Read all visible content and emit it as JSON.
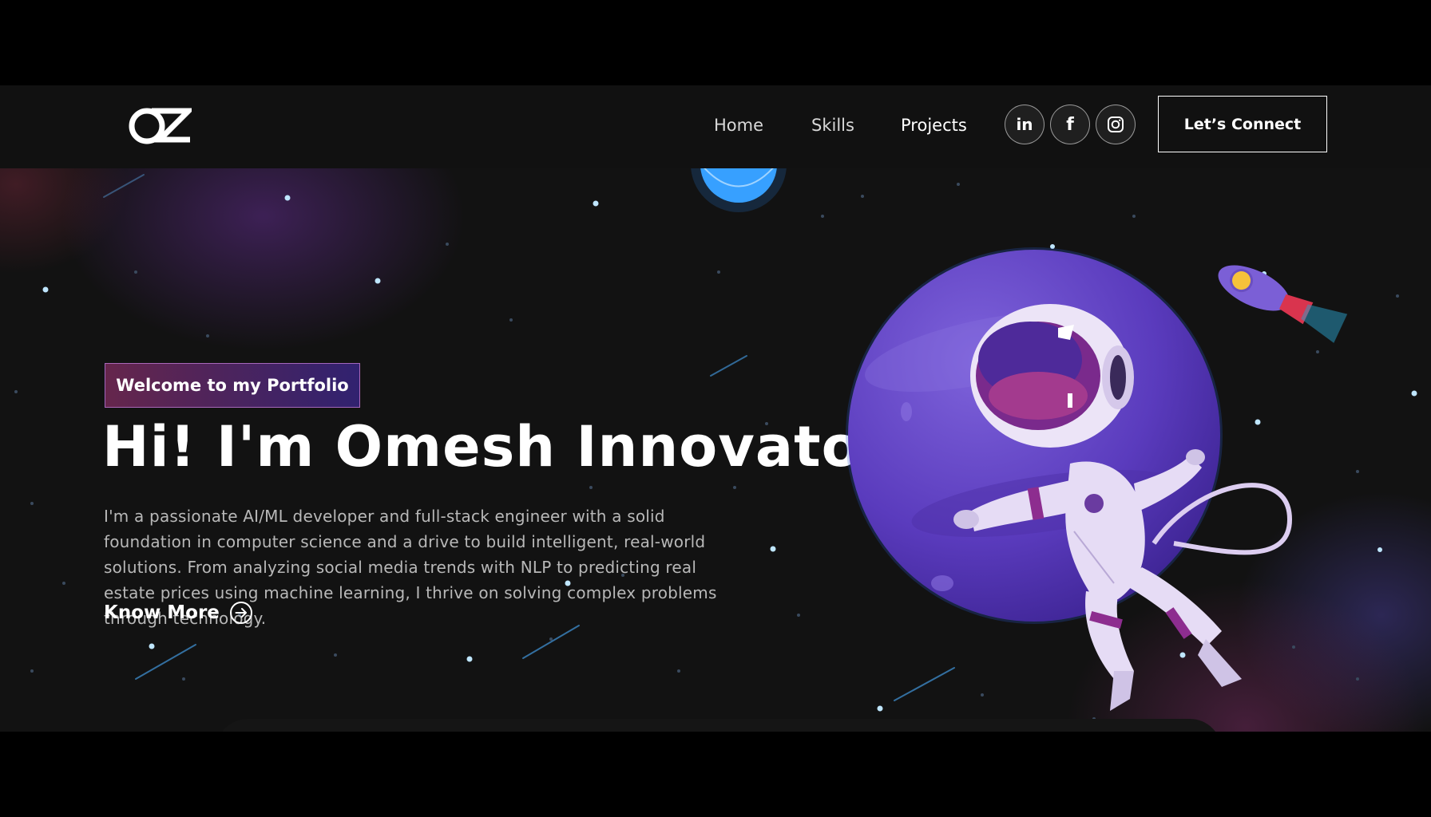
{
  "navbar": {
    "logo_text": "OZ",
    "links": [
      "Home",
      "Skills",
      "Projects"
    ],
    "socials": [
      {
        "name": "linkedin-icon",
        "glyph": "in"
      },
      {
        "name": "facebook-icon",
        "glyph": "f"
      },
      {
        "name": "instagram-icon",
        "glyph": ""
      }
    ],
    "connect_label": "Let’s Connect"
  },
  "hero": {
    "badge": "Welcome to my Portfolio",
    "headline": "Hi! I'm Omesh Innovato",
    "intro": "I'm a passionate AI/ML developer and full-stack engineer with a solid foundation in computer science and a drive to build intelligent, real-world solutions. From analyzing social media trends with NLP to predicting real estate prices using machine learning, I thrive on solving complex problems through technology.",
    "cta_label": "Know More"
  },
  "colors": {
    "background": "#121212",
    "navbar": "#111111",
    "badge_start": "#aa367c",
    "badge_end": "#4a2fbd",
    "planet": "#6b4fc8"
  }
}
